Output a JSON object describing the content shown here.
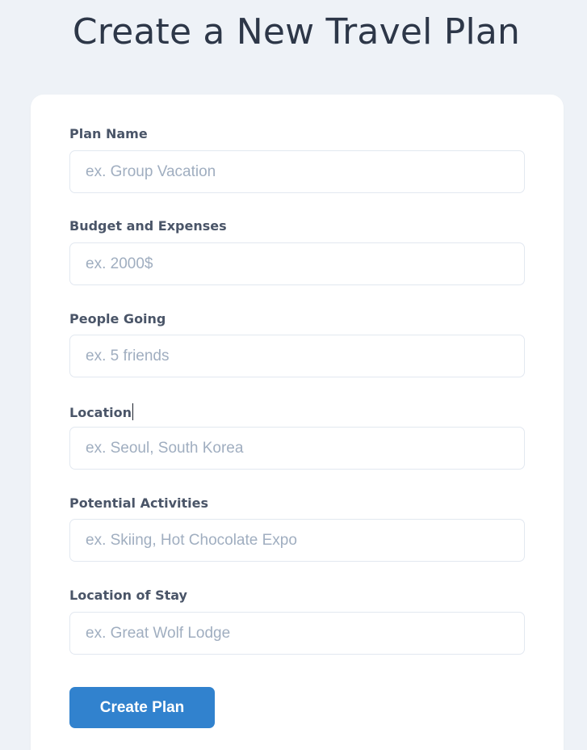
{
  "header": {
    "title": "Create a New Travel Plan"
  },
  "form": {
    "fields": [
      {
        "label": "Plan Name",
        "placeholder": "ex. Group Vacation",
        "value": ""
      },
      {
        "label": "Budget and Expenses",
        "placeholder": "ex. 2000$",
        "value": ""
      },
      {
        "label": "People Going",
        "placeholder": "ex. 5 friends",
        "value": ""
      },
      {
        "label": "Location",
        "placeholder": "ex. Seoul, South Korea",
        "value": ""
      },
      {
        "label": "Potential Activities",
        "placeholder": "ex. Skiing, Hot Chocolate Expo",
        "value": ""
      },
      {
        "label": "Location of Stay",
        "placeholder": "ex. Great Wolf Lodge",
        "value": ""
      }
    ],
    "submit_label": "Create Plan"
  },
  "colors": {
    "background": "#eef2f7",
    "card": "#ffffff",
    "title": "#2d3748",
    "label": "#4a5568",
    "placeholder": "#a0aec0",
    "input_border": "#e2e8f0",
    "accent": "#3182ce"
  }
}
